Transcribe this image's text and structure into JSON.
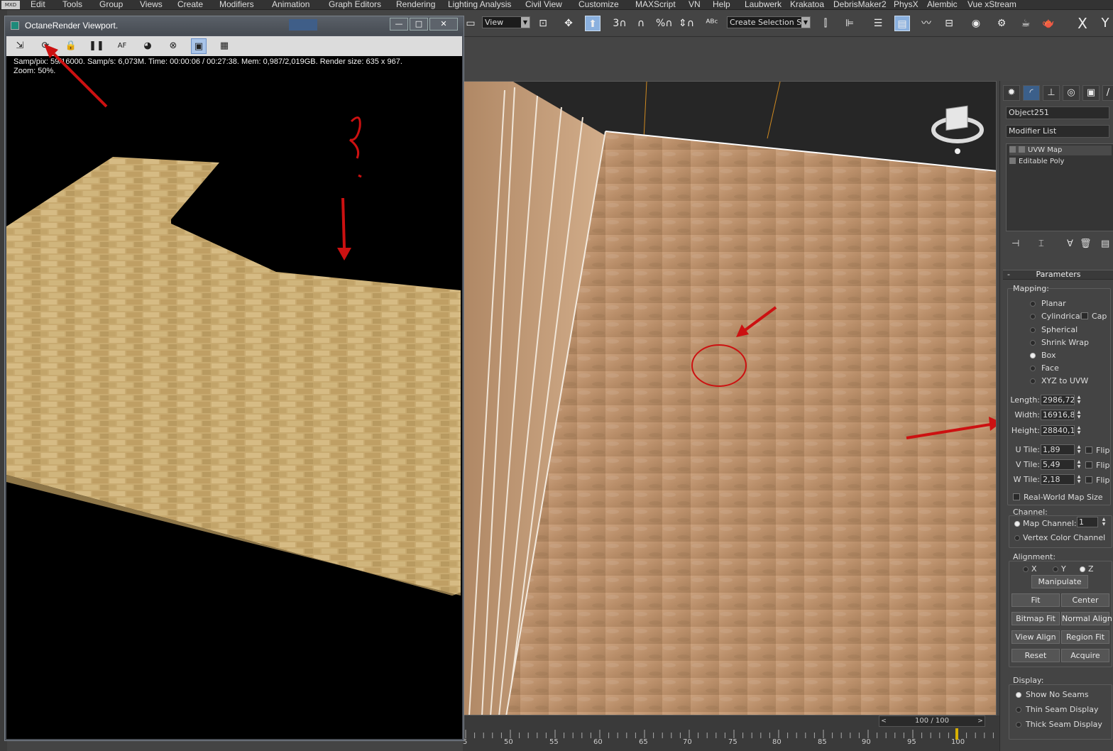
{
  "menubar": {
    "logo": "MXD",
    "items": [
      "Edit",
      "Tools",
      "Group",
      "Views",
      "Create",
      "Modifiers",
      "Animation",
      "Graph Editors",
      "Rendering",
      "Lighting Analysis",
      "Civil View",
      "Customize",
      "MAXScript",
      "VN",
      "Help",
      "Laubwerk",
      "Krakatoa",
      "DebrisMaker2",
      "PhysX",
      "Alembic",
      "Vue xStream"
    ]
  },
  "toolbar": {
    "view_select": "View",
    "selection_set": "Create Selection Se",
    "close_glyph": "X",
    "y_glyph": "Y"
  },
  "render_window": {
    "title": "OctaneRender Viewport.",
    "stats_line1": "Samp/pix: 59/16000.   Samp/s: 6,073M.   Time: 00:00:06 / 00:27:38.   Mem: 0,987/2,019GB.   Render size: 635 x 967.",
    "stats_line2": "Zoom: 50%.",
    "annotation": "?"
  },
  "command_panel": {
    "object_name": "Object251",
    "modifier_list": "Modifier List",
    "stack": [
      "UVW Map",
      "Editable Poly"
    ],
    "rollout_title": "Parameters",
    "mapping": {
      "title": "Mapping:",
      "options": [
        "Planar",
        "Cylindrical",
        "Spherical",
        "Shrink Wrap",
        "Box",
        "Face",
        "XYZ to UVW"
      ],
      "selected": "Box",
      "cap_label": "Cap"
    },
    "dimensions": {
      "length_label": "Length:",
      "length": "2986,72",
      "width_label": "Width:",
      "width": "16916,8",
      "height_label": "Height:",
      "height": "28840,1"
    },
    "tiles": {
      "u_label": "U Tile:",
      "u": "1,89",
      "v_label": "V Tile:",
      "v": "5,49",
      "w_label": "W Tile:",
      "w": "2,18",
      "flip_label": "Flip"
    },
    "real_world": "Real-World Map Size",
    "channel": {
      "title": "Channel:",
      "map_channel_label": "Map Channel:",
      "map_channel_value": "1",
      "vertex_color_label": "Vertex Color Channel"
    },
    "alignment": {
      "title": "Alignment:",
      "axes": [
        "X",
        "Y",
        "Z"
      ],
      "selected_axis": "Z",
      "buttons": [
        "Manipulate",
        "Fit",
        "Center",
        "Bitmap Fit",
        "Normal Align",
        "View Align",
        "Region Fit",
        "Reset",
        "Acquire"
      ]
    },
    "display": {
      "title": "Display:",
      "options": [
        "Show No Seams",
        "Thin Seam Display",
        "Thick Seam Display"
      ],
      "selected": "Show No Seams"
    }
  },
  "timeline": {
    "frame_label": "100 / 100",
    "ticks": [
      "5",
      "50",
      "55",
      "60",
      "65",
      "70",
      "75",
      "80",
      "85",
      "90",
      "95",
      "100"
    ]
  },
  "colors": {
    "annotation_red": "#cc1111",
    "viewport_bg": "#262626",
    "keyline": "#d8b000"
  }
}
